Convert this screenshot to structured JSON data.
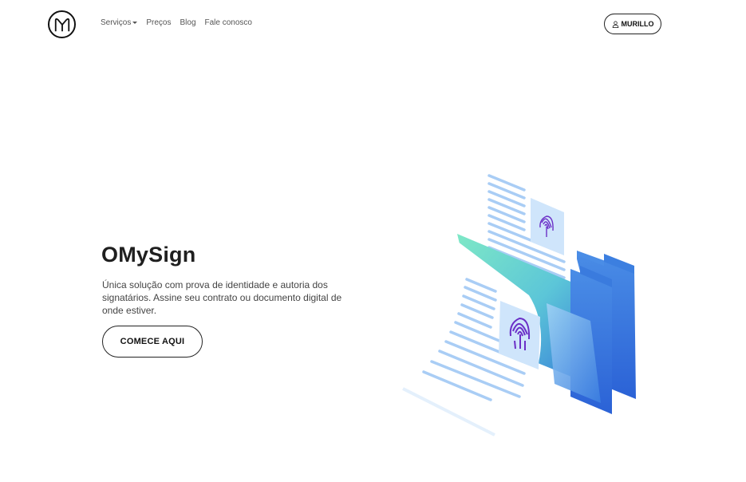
{
  "brand": {
    "logo_icon": "omysign-m-logo-icon"
  },
  "nav": {
    "items": [
      {
        "label": "Serviços",
        "dropdown": true
      },
      {
        "label": "Preços"
      },
      {
        "label": "Blog"
      },
      {
        "label": "Fale conosco"
      }
    ]
  },
  "user": {
    "label": "MURILLO",
    "icon": "user-icon"
  },
  "hero": {
    "title": "OMySign",
    "description": "Única solução com prova de identidade e autoria dos signatários. Assine seu contrato ou documento digital de onde estiver.",
    "cta_label": "COMECE AQUI"
  },
  "illustration": {
    "icon": "signed-documents-fingerprint-illustration"
  },
  "colors": {
    "text": "#1f1f1f",
    "nav_text": "#555555",
    "folder_blue": "#2f6fd8",
    "doc_line": "#a9cdf5",
    "fingerprint": "#6b2fc7",
    "mint": "#7ee8c6"
  }
}
